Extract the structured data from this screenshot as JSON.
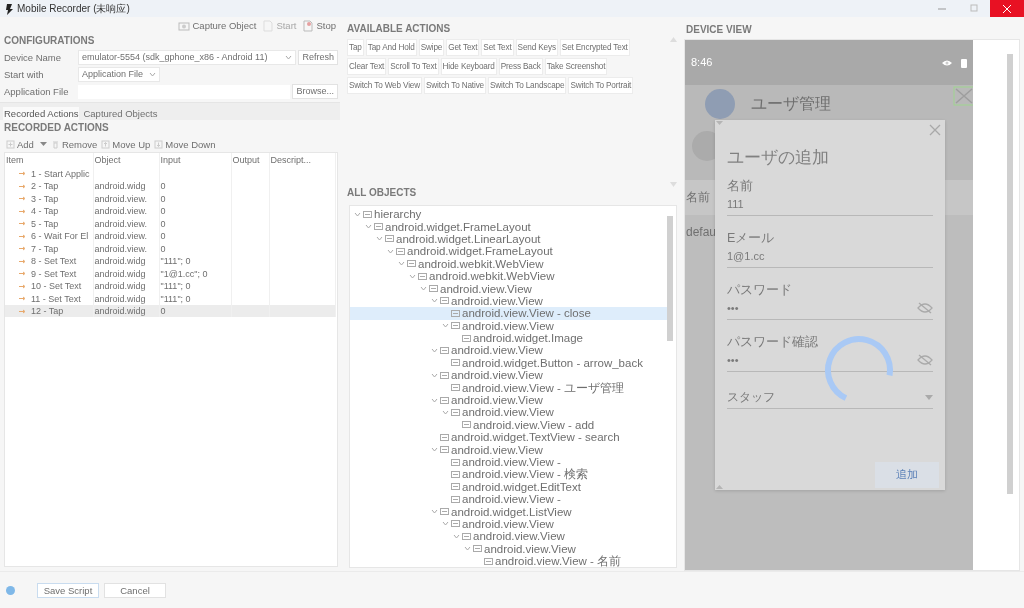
{
  "window": {
    "title": "Mobile Recorder (未响应)"
  },
  "toolbar": [
    {
      "label": "Capture Object",
      "disabled": false
    },
    {
      "label": "Start",
      "disabled": true
    },
    {
      "label": "Stop",
      "disabled": false
    }
  ],
  "configurations": {
    "heading": "CONFIGURATIONS",
    "device_name": {
      "label": "Device Name",
      "value": "emulator-5554 (sdk_gphone_x86 - Android 11)",
      "button": "Refresh"
    },
    "start_with": {
      "label": "Start with",
      "value": "Application File"
    },
    "application_file": {
      "label": "Application File",
      "button": "Browse..."
    }
  },
  "tabs": [
    {
      "label": "Recorded Actions",
      "selected": true
    },
    {
      "label": "Captured Objects",
      "selected": false
    }
  ],
  "recorded_actions": {
    "heading": "RECORDED ACTIONS",
    "tools": [
      "Add",
      "Remove",
      "Move Up",
      "Move Down"
    ],
    "columns": [
      "Item",
      "Object",
      "Input",
      "Output",
      "Descript..."
    ],
    "rows": [
      {
        "item": "1 - Start Applic",
        "selected": false
      },
      {
        "item": "2 - Tap",
        "object": "android.widg",
        "input": "0",
        "selected": false
      },
      {
        "item": "3 - Tap",
        "object": "android.view.",
        "input": "0",
        "selected": false
      },
      {
        "item": "4 - Tap",
        "object": "android.view.",
        "input": "0",
        "selected": false
      },
      {
        "item": "5 - Tap",
        "object": "android.view.",
        "input": "0",
        "selected": false
      },
      {
        "item": "6 - Wait For El",
        "object": "android.view.",
        "input": "0",
        "selected": false
      },
      {
        "item": "7 - Tap",
        "object": "android.view.",
        "input": "0",
        "selected": false
      },
      {
        "item": "8 - Set Text",
        "object": "android.widg",
        "input": "\"111\"; 0",
        "selected": false
      },
      {
        "item": "9 - Set Text",
        "object": "android.widg",
        "input": "\"1@1.cc\"; 0",
        "selected": false
      },
      {
        "item": "10 - Set Text",
        "object": "android.widg",
        "input": "\"111\"; 0",
        "selected": false
      },
      {
        "item": "11 - Set Text",
        "object": "android.widg",
        "input": "\"111\"; 0",
        "selected": false
      },
      {
        "item": "12 - Tap",
        "object": "android.widg",
        "input": "0",
        "selected": true
      }
    ]
  },
  "available_actions": {
    "heading": "AVAILABLE ACTIONS",
    "buttons": [
      "Tap",
      "Tap And Hold",
      "Swipe",
      "Get Text",
      "Set Text",
      "Send Keys",
      "Set Encrypted Text",
      "Clear Text",
      "Scroll To Text",
      "Hide Keyboard",
      "Press Back",
      "Take Screenshot",
      "Switch To Web View",
      "Switch To Native",
      "Switch To Landscape",
      "Switch To Portrait"
    ]
  },
  "all_objects": {
    "heading": "ALL OBJECTS",
    "tree": [
      {
        "label": "hierarchy",
        "selected": false,
        "expanded": true,
        "children": [
          {
            "label": "android.widget.FrameLayout",
            "selected": false,
            "expanded": true,
            "children": [
              {
                "label": "android.widget.LinearLayout",
                "selected": false,
                "expanded": true,
                "children": [
                  {
                    "label": "android.widget.FrameLayout",
                    "selected": false,
                    "expanded": true,
                    "children": [
                      {
                        "label": "android.webkit.WebView",
                        "selected": false,
                        "expanded": true,
                        "children": [
                          {
                            "label": "android.webkit.WebView",
                            "selected": false,
                            "expanded": true,
                            "children": [
                              {
                                "label": "android.view.View",
                                "selected": false,
                                "expanded": true,
                                "children": [
                                  {
                                    "label": "android.view.View",
                                    "selected": false,
                                    "expanded": true,
                                    "children": [
                                      {
                                        "label": "android.view.View - close",
                                        "selected": true
                                      },
                                      {
                                        "label": "android.view.View",
                                        "selected": false,
                                        "expanded": true,
                                        "children": [
                                          {
                                            "label": "android.widget.Image",
                                            "selected": false
                                          }
                                        ]
                                      }
                                    ]
                                  },
                                  {
                                    "label": "android.view.View",
                                    "selected": false,
                                    "expanded": true,
                                    "children": [
                                      {
                                        "label": "android.widget.Button - arrow_back",
                                        "selected": false
                                      }
                                    ]
                                  },
                                  {
                                    "label": "android.view.View",
                                    "selected": false,
                                    "expanded": true,
                                    "children": [
                                      {
                                        "label": "android.view.View - ユーザ管理",
                                        "selected": false
                                      }
                                    ]
                                  },
                                  {
                                    "label": "android.view.View",
                                    "selected": false,
                                    "expanded": true,
                                    "children": [
                                      {
                                        "label": "android.view.View",
                                        "selected": false,
                                        "expanded": true,
                                        "children": [
                                          {
                                            "label": "android.view.View - add",
                                            "selected": false
                                          }
                                        ]
                                      }
                                    ]
                                  },
                                  {
                                    "label": "android.widget.TextView - search",
                                    "selected": false
                                  },
                                  {
                                    "label": "android.view.View",
                                    "selected": false,
                                    "expanded": true,
                                    "children": [
                                      {
                                        "label": "android.view.View -",
                                        "selected": false
                                      },
                                      {
                                        "label": "android.view.View - 検索",
                                        "selected": false
                                      },
                                      {
                                        "label": "android.widget.EditText",
                                        "selected": false
                                      },
                                      {
                                        "label": "android.view.View -",
                                        "selected": false
                                      }
                                    ]
                                  },
                                  {
                                    "label": "android.widget.ListView",
                                    "selected": false,
                                    "expanded": true,
                                    "children": [
                                      {
                                        "label": "android.view.View",
                                        "selected": false,
                                        "expanded": true,
                                        "children": [
                                          {
                                            "label": "android.view.View",
                                            "selected": false,
                                            "expanded": true,
                                            "children": [
                                              {
                                                "label": "android.view.View",
                                                "selected": false,
                                                "expanded": true,
                                                "children": [
                                                  {
                                                    "label": "android.view.View - 名前",
                                                    "selected": false
                                                  }
                                                ]
                                              }
                                            ]
                                          }
                                        ]
                                      }
                                    ]
                                  }
                                ]
                              }
                            ]
                          }
                        ]
                      }
                    ]
                  }
                ]
              }
            ]
          }
        ]
      }
    ]
  },
  "device_view": {
    "heading": "DEVICE VIEW",
    "phone": {
      "time": "8:46",
      "header_title": "ユーザ管理",
      "column": "名前",
      "cell": "defau",
      "dialog": {
        "title": "ユーザの追加",
        "fields": [
          {
            "kind": "text",
            "label": "名前",
            "value": "111"
          },
          {
            "kind": "text",
            "label": "Eメール",
            "value": "1@1.cc"
          },
          {
            "kind": "password",
            "label": "パスワード",
            "value": "•••"
          },
          {
            "kind": "password",
            "label": "パスワード確認",
            "value": "•••"
          }
        ],
        "select": "スタッフ",
        "submit": "追加"
      }
    }
  },
  "footer": {
    "buttons": [
      "Save Script",
      "Cancel"
    ]
  }
}
